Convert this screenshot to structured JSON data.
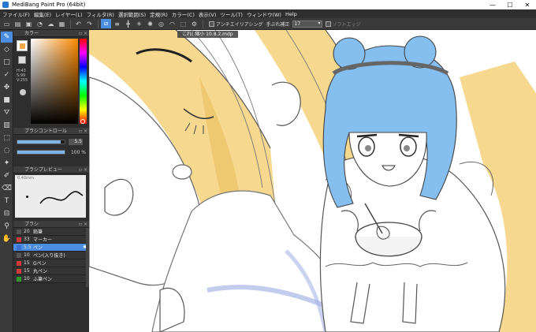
{
  "window": {
    "title": "MediBang Paint Pro (64bit)",
    "minimize": "—",
    "maximize": "☐",
    "close": "✕"
  },
  "menu": [
    "ファイル(F)",
    "編集(E)",
    "レイヤー(L)",
    "フィルタ(R)",
    "選択範囲(S)",
    "定規(R)",
    "カラー(C)",
    "表示(V)",
    "ツール(T)",
    "ウィンドウ(W)",
    "Help"
  ],
  "toolbar": {
    "antialias_label": "アンチエイリアシング",
    "correction_label": "手ぶれ補正",
    "correction_value": "17",
    "soft_edge_label": "ソフトエッジ"
  },
  "panels": {
    "color_title": "カラー",
    "hsv": {
      "h": "H:43",
      "s": "S:99",
      "v": "V:255"
    },
    "brush_control_title": "ブラシコントロール",
    "brush_size": "5.5",
    "brush_opacity": "100 %",
    "brush_opacity_fraction": 1.0,
    "brush_size_fraction": 0.92,
    "preview_title": "ブラシプレビュー",
    "preview_size": "0.40mm",
    "brush_title": "ブラシ"
  },
  "brushes": [
    {
      "size": "20",
      "name": "鉛筆",
      "color": "#555555"
    },
    {
      "size": "33",
      "name": "マーカー",
      "color": "#d23a3a"
    },
    {
      "size": "5.5",
      "name": "ペン",
      "color": "#3a6fd2"
    },
    {
      "size": "10",
      "name": "ペン(入り抜き)",
      "color": "#555555"
    },
    {
      "size": "15",
      "name": "Gペン",
      "color": "#d23a3a"
    },
    {
      "size": "15",
      "name": "丸ペン",
      "color": "#d23a3a"
    },
    {
      "size": "10",
      "name": "ふ筆ペン",
      "color": "#2a9a2a"
    }
  ],
  "selected_brush_index": 2,
  "document_tab": "これ( 縮小 10.8.2.mdp",
  "colors": {
    "accent": "#4b8de0",
    "hair_yellow": "#f6d88f",
    "hair_blue": "#84bff0"
  }
}
